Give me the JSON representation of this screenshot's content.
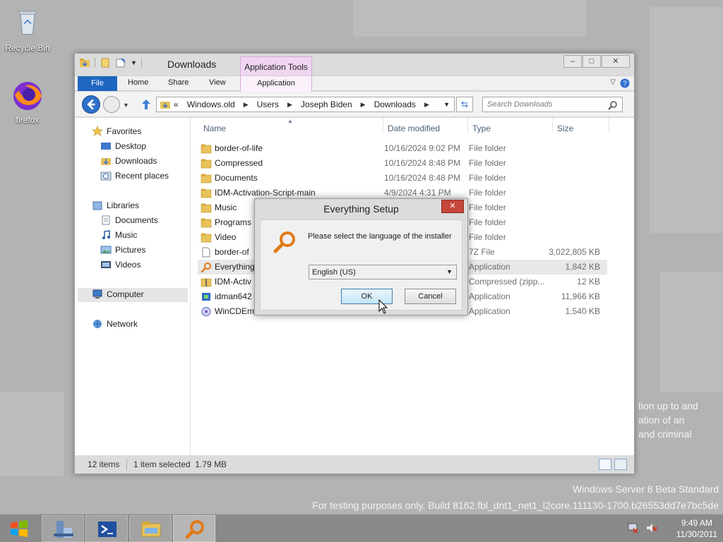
{
  "desktop": {
    "icons": [
      {
        "label": "Recycle Bin"
      },
      {
        "label": "firefox"
      }
    ],
    "watermark_line1": "Windows Server 8 Beta Standard",
    "watermark_line2": "For testing purposes only. Build 8162.fbl_dnt1_net1_l2core.111130-1700.b26553dd7e7bc5de",
    "bg_text": [
      "tion up to and",
      "ation of an",
      "and criminal"
    ]
  },
  "explorer": {
    "title": "Downloads",
    "context_tab_group": "Application Tools",
    "ribbon_tabs": [
      "File",
      "Home",
      "Share",
      "View"
    ],
    "context_tab": "Application",
    "window_buttons": [
      "–",
      "□",
      "✕"
    ],
    "breadcrumb": [
      "Windows.old",
      "Users",
      "Joseph Biden",
      "Downloads"
    ],
    "breadcrumb_overflow": "«",
    "search_placeholder": "Search Downloads",
    "nav": {
      "favorites_label": "Favorites",
      "favorites": [
        "Desktop",
        "Downloads",
        "Recent places"
      ],
      "libraries_label": "Libraries",
      "libraries": [
        "Documents",
        "Music",
        "Pictures",
        "Videos"
      ],
      "computer": "Computer",
      "network": "Network"
    },
    "columns": {
      "name": "Name",
      "date": "Date modified",
      "type": "Type",
      "size": "Size"
    },
    "files": [
      {
        "name": "border-of-life",
        "date": "10/16/2024 9:02 PM",
        "type": "File folder",
        "size": ""
      },
      {
        "name": "Compressed",
        "date": "10/16/2024 8:48 PM",
        "type": "File folder",
        "size": ""
      },
      {
        "name": "Documents",
        "date": "10/16/2024 8:48 PM",
        "type": "File folder",
        "size": ""
      },
      {
        "name": "IDM-Activation-Script-main",
        "date": "4/9/2024 4:31 PM",
        "type": "File folder",
        "size": ""
      },
      {
        "name": "Music",
        "date": "",
        "type": "File folder",
        "size": ""
      },
      {
        "name": "Programs",
        "date": "",
        "type": "File folder",
        "size": ""
      },
      {
        "name": "Video",
        "date": "",
        "type": "File folder",
        "size": ""
      },
      {
        "name": "border-of",
        "date": "",
        "type": "7Z File",
        "size": "3,022,805 KB"
      },
      {
        "name": "Everything",
        "date": "",
        "type": "Application",
        "size": "1,842 KB"
      },
      {
        "name": "IDM-Activ",
        "date": "",
        "type": "Compressed (zipp...",
        "size": "12 KB"
      },
      {
        "name": "idman642",
        "date": "",
        "type": "Application",
        "size": "11,966 KB"
      },
      {
        "name": "WinCDEm",
        "date": "",
        "type": "Application",
        "size": "1,540 KB"
      }
    ],
    "status": {
      "items": "12 items",
      "selected": "1 item selected  1.79 MB"
    }
  },
  "dialog": {
    "title": "Everything Setup",
    "close": "✕",
    "message": "Please select the language of the installer",
    "language": "English (US)",
    "ok": "OK",
    "cancel": "Cancel"
  },
  "taskbar": {
    "time": "9:49 AM",
    "date": "11/30/2011"
  },
  "colors": {
    "file_tab": "#1f66c1",
    "context_tab": "#f0d6f2",
    "dialog_close": "#c7463b",
    "desktop": "#b3b3b3"
  }
}
